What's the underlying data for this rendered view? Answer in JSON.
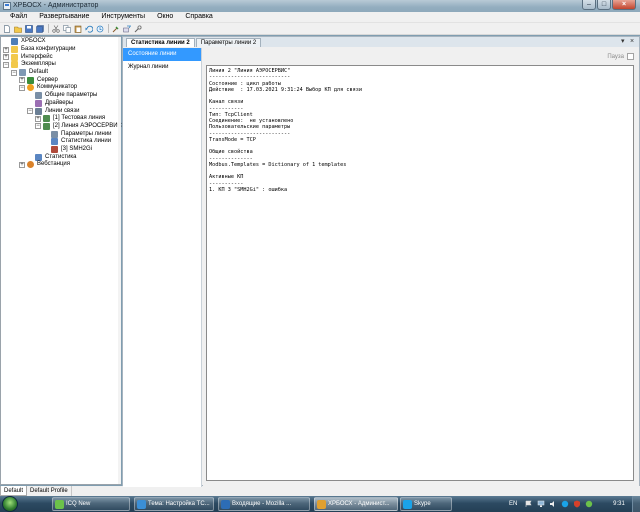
{
  "window": {
    "title": "ХРБОСХ - Администратор"
  },
  "menu": [
    "Файл",
    "Развертывание",
    "Инструменты",
    "Окно",
    "Справка"
  ],
  "toolbar_icons": [
    "new-icon",
    "open-icon",
    "save-icon",
    "save-all-icon",
    "cut-icon",
    "copy-icon",
    "paste-icon",
    "undo-icon",
    "redo-icon",
    "settings-icon",
    "tools-icon",
    "wrench-icon"
  ],
  "explorer": {
    "items": [
      {
        "label": "ХРБОСХ",
        "level": 0,
        "expander": "",
        "icon": "project-icon"
      },
      {
        "label": "База конфигурации",
        "level": 0,
        "expander": "+",
        "icon": "folder-icon"
      },
      {
        "label": "Интерфейс",
        "level": 0,
        "expander": "+",
        "icon": "folder-icon"
      },
      {
        "label": "Экземпляры",
        "level": 0,
        "expander": "-",
        "icon": "folder-icon"
      },
      {
        "label": "Default",
        "level": 1,
        "expander": "-",
        "icon": "instance-icon"
      },
      {
        "label": "Сервер",
        "level": 2,
        "expander": "+",
        "icon": "server-icon"
      },
      {
        "label": "Коммуникатор",
        "level": 2,
        "expander": "-",
        "icon": "communicator-icon"
      },
      {
        "label": "Общие параметры",
        "level": 3,
        "expander": "",
        "icon": "params-icon"
      },
      {
        "label": "Драйверы",
        "level": 3,
        "expander": "",
        "icon": "drivers-icon"
      },
      {
        "label": "Линии связи",
        "level": 3,
        "expander": "-",
        "icon": "lines-icon"
      },
      {
        "label": "[1] Тестовая линия",
        "level": 4,
        "expander": "+",
        "icon": "line-icon"
      },
      {
        "label": "[2] Линия АЭРОСЕРВИС",
        "level": 4,
        "expander": "-",
        "icon": "line-icon"
      },
      {
        "label": "Параметры линии",
        "level": 5,
        "expander": "",
        "icon": "params-icon"
      },
      {
        "label": "Статистика линии",
        "level": 5,
        "expander": "",
        "icon": "stats-icon"
      },
      {
        "label": "[3] SMH2Gi",
        "level": 5,
        "expander": "",
        "icon": "device-icon"
      },
      {
        "label": "Статистика",
        "level": 3,
        "expander": "",
        "icon": "stats-icon"
      },
      {
        "label": "Вебстанция",
        "level": 2,
        "expander": "+",
        "icon": "web-icon"
      }
    ]
  },
  "profile_tabs": [
    "Default",
    "Default Profile"
  ],
  "doc_tabs": [
    "Статистика линии 2",
    "Параметры линии 2"
  ],
  "doc_tab_controls": {
    "dropdown": "▾",
    "close": "×"
  },
  "sidenav": [
    "Состояние линии",
    "Журнал линии"
  ],
  "pause_label": "Пауза",
  "log_lines": [
    "Линия 2 \"Линия АЭРОСЕРВИС\"",
    "--------------------------",
    "Состояние : цикл работы",
    "Действие  : 17.03.2021 9:31:24 Выбор КП для связи",
    "",
    "Канал связи",
    "-----------",
    "Тип: TcpClient",
    "Соединение:  не установлено",
    "Пользовательские параметры",
    "--------------------------",
    "TransMode = TCP",
    "",
    "Общие свойства",
    "--------------",
    "Modbus.Templates = Dictionary of 1 templates",
    "",
    "Активные КП",
    "-----------",
    "1. КП 3 \"SMH2Gi\" : ошибка"
  ],
  "taskbar": {
    "items": [
      {
        "label": "ICQ New",
        "icon": "icq-icon",
        "color": "#6cc24a"
      },
      {
        "label": "Тема: Настройка ТС...",
        "icon": "browser-icon",
        "color": "#3b8fd6"
      },
      {
        "label": "Входящие - Mozilla ...",
        "icon": "thunderbird-icon",
        "color": "#2d6db5"
      },
      {
        "label": "ХРБОСХ - Админист...",
        "icon": "app-icon",
        "color": "#e0a030"
      },
      {
        "label": "Skype",
        "icon": "skype-icon",
        "color": "#1aa3e8"
      }
    ],
    "lang": "EN",
    "clock": "9:31"
  },
  "colors": {
    "accent": "#3399ff",
    "taskbar": "#2c4a62"
  }
}
